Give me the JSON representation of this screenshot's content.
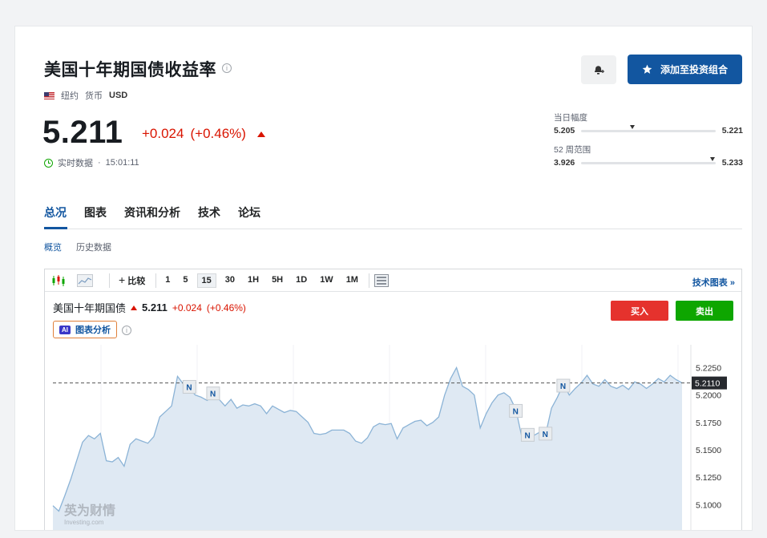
{
  "header": {
    "title": "美国十年期国债收益率",
    "location": "纽约",
    "currency_label": "货币",
    "currency": "USD",
    "price": "5.211",
    "change": "+0.024",
    "change_pct": "(+0.46%)",
    "realtime_label": "实时数据",
    "time": "15:01:11",
    "add_portfolio": "添加至投资组合"
  },
  "ranges": {
    "day_label": "当日幅度",
    "day_low": "5.205",
    "day_high": "5.221",
    "day_position": 0.38,
    "week_label": "52 周范围",
    "week_low": "3.926",
    "week_high": "5.233",
    "week_position": 0.98
  },
  "nav": {
    "tabs": [
      "总况",
      "图表",
      "资讯和分析",
      "技术",
      "论坛"
    ]
  },
  "subnav": {
    "tabs": [
      "概览",
      "历史数据"
    ]
  },
  "toolbar": {
    "compare": "比较",
    "intervals": [
      "1",
      "5",
      "15",
      "30",
      "1H",
      "5H",
      "1D",
      "1W",
      "1M"
    ],
    "selected_interval": "15",
    "tech_chart": "技术图表"
  },
  "chart_header": {
    "name": "美国十年期国债",
    "price": "5.211",
    "change": "+0.024",
    "change_pct": "(+0.46%)",
    "ai_badge": "AI",
    "ai_label": "图表分析",
    "buy": "买入",
    "sell": "卖出"
  },
  "watermark": {
    "brand": "英为财情",
    "sub": "Investing.com"
  },
  "colors": {
    "accent": "#1256a0",
    "down_red": "#d91400",
    "up_green": "#0ea600",
    "area_fill": "#dfe9f3",
    "line": "#8bb3d6"
  },
  "chart_data": {
    "type": "area",
    "ylim": [
      5.09,
      5.24
    ],
    "yticks": [
      "5.2250",
      "5.2000",
      "5.1750",
      "5.1500",
      "5.1250",
      "5.1000"
    ],
    "ytick_values": [
      5.225,
      5.2,
      5.175,
      5.15,
      5.125,
      5.1
    ],
    "last_value": 5.211,
    "last_label": "5.2110",
    "news_markers": [
      "N",
      "N",
      "N",
      "N",
      "N",
      "N"
    ],
    "values": [
      5.099,
      5.094,
      5.108,
      5.123,
      5.14,
      5.157,
      5.163,
      5.16,
      5.165,
      5.14,
      5.139,
      5.143,
      5.135,
      5.155,
      5.16,
      5.158,
      5.156,
      5.162,
      5.18,
      5.185,
      5.19,
      5.217,
      5.21,
      5.206,
      5.2,
      5.198,
      5.195,
      5.2,
      5.196,
      5.19,
      5.196,
      5.188,
      5.191,
      5.19,
      5.192,
      5.19,
      5.183,
      5.19,
      5.187,
      5.184,
      5.186,
      5.185,
      5.18,
      5.175,
      5.165,
      5.164,
      5.165,
      5.168,
      5.168,
      5.168,
      5.165,
      5.158,
      5.156,
      5.161,
      5.171,
      5.174,
      5.173,
      5.174,
      5.16,
      5.17,
      5.173,
      5.176,
      5.177,
      5.172,
      5.175,
      5.18,
      5.2,
      5.215,
      5.225,
      5.208,
      5.205,
      5.2,
      5.17,
      5.183,
      5.193,
      5.2,
      5.202,
      5.198,
      5.187,
      5.162,
      5.16,
      5.163,
      5.166,
      5.164,
      5.188,
      5.198,
      5.21,
      5.2,
      5.206,
      5.211,
      5.218,
      5.21,
      5.208,
      5.214,
      5.208,
      5.206,
      5.209,
      5.205,
      5.212,
      5.21,
      5.206,
      5.21,
      5.215,
      5.212,
      5.218,
      5.214,
      5.211
    ]
  }
}
